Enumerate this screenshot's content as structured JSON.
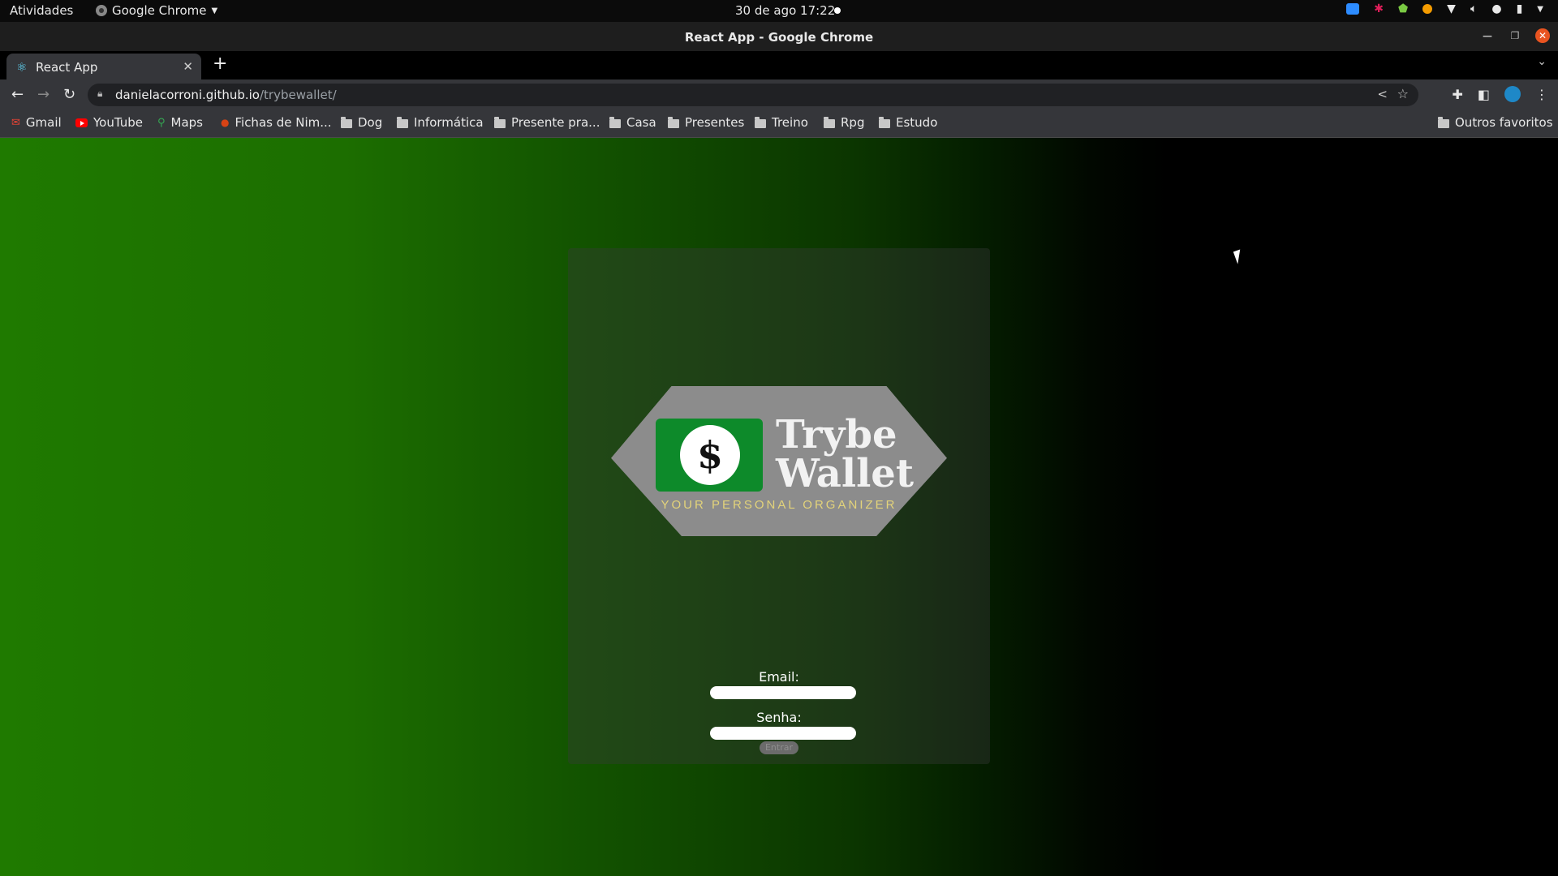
{
  "system": {
    "activities": "Atividades",
    "app_name": "Google Chrome",
    "datetime": "30 de ago  17:22"
  },
  "window": {
    "title": "React App - Google Chrome"
  },
  "tabs": [
    {
      "title": "React App",
      "favicon": "react-icon"
    }
  ],
  "address_bar": {
    "host": "danielacorroni.github.io",
    "path": "/trybewallet/"
  },
  "bookmarks": [
    {
      "label": "Gmail",
      "icon": "gmail-icon"
    },
    {
      "label": "YouTube",
      "icon": "youtube-icon"
    },
    {
      "label": "Maps",
      "icon": "maps-icon"
    },
    {
      "label": "Fichas de Nim...",
      "icon": "fichas-icon"
    },
    {
      "label": "Dog",
      "icon": "folder-icon"
    },
    {
      "label": "Informática",
      "icon": "folder-icon"
    },
    {
      "label": "Presente pra...",
      "icon": "folder-icon"
    },
    {
      "label": "Casa",
      "icon": "folder-icon"
    },
    {
      "label": "Presentes",
      "icon": "folder-icon"
    },
    {
      "label": "Treino",
      "icon": "folder-icon"
    },
    {
      "label": "Rpg",
      "icon": "folder-icon"
    },
    {
      "label": "Estudo",
      "icon": "folder-icon"
    }
  ],
  "other_bookmarks": "Outros favoritos",
  "page": {
    "logo": {
      "symbol": "$",
      "brand_line1": "Trybe",
      "brand_line2": "Wallet",
      "tagline": "YOUR PERSONAL ORGANIZER"
    },
    "email_label": "Email:",
    "email_value": "",
    "password_label": "Senha:",
    "password_value": "",
    "submit_label": "Entrar"
  },
  "colors": {
    "gradient_green": "#1f7a00",
    "logo_green": "#0d8a2a",
    "logo_gray": "#8c8c8c",
    "tagline_gold": "#e3d37a"
  }
}
